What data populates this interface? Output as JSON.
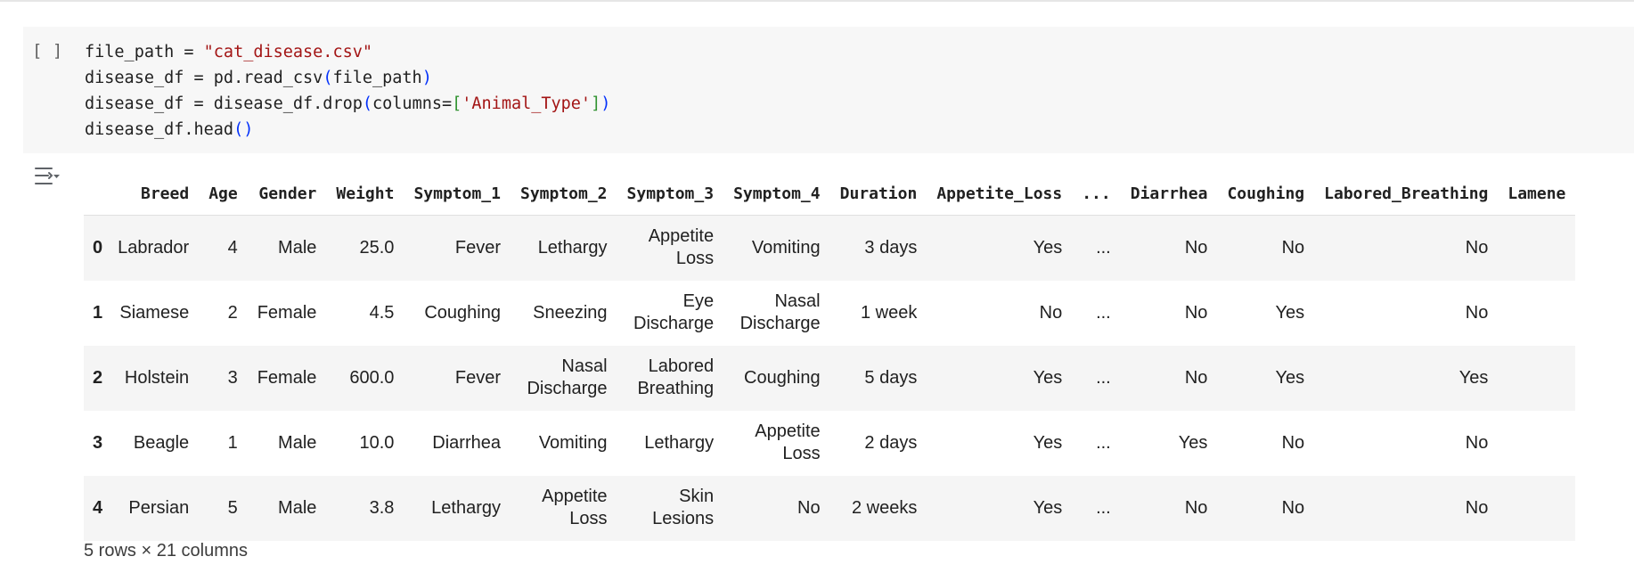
{
  "cell": {
    "run_indicator": "[ ]",
    "code": {
      "line1": {
        "a": "file_path = ",
        "s": "\"cat_disease.csv\""
      },
      "line2": {
        "a": "disease_df = pd.read_csv",
        "p1": "(",
        "b": "file_path",
        "p2": ")"
      },
      "line3": {
        "a": "disease_df = disease_df.drop",
        "p1": "(",
        "b": "columns=",
        "k1": "[",
        "s": "'Animal_Type'",
        "k2": "]",
        "p2": ")"
      },
      "line4": {
        "a": "disease_df.head",
        "p": "()"
      }
    }
  },
  "output": {
    "icon": "output-options-icon",
    "columns": [
      "",
      "Breed",
      "Age",
      "Gender",
      "Weight",
      "Symptom_1",
      "Symptom_2",
      "Symptom_3",
      "Symptom_4",
      "Duration",
      "Appetite_Loss",
      "...",
      "Diarrhea",
      "Coughing",
      "Labored_Breathing",
      "Lamene"
    ],
    "rows": [
      {
        "index": "0",
        "cells": [
          "Labrador",
          "4",
          "Male",
          "25.0",
          "Fever",
          "Lethargy",
          [
            "Appetite",
            "Loss"
          ],
          "Vomiting",
          "3 days",
          "Yes",
          "...",
          "No",
          "No",
          "No",
          ""
        ]
      },
      {
        "index": "1",
        "cells": [
          "Siamese",
          "2",
          "Female",
          "4.5",
          "Coughing",
          "Sneezing",
          [
            "Eye",
            "Discharge"
          ],
          [
            "Nasal",
            "Discharge"
          ],
          "1 week",
          "No",
          "...",
          "No",
          "Yes",
          "No",
          ""
        ]
      },
      {
        "index": "2",
        "cells": [
          "Holstein",
          "3",
          "Female",
          "600.0",
          "Fever",
          [
            "Nasal",
            "Discharge"
          ],
          [
            "Labored",
            "Breathing"
          ],
          "Coughing",
          "5 days",
          "Yes",
          "...",
          "No",
          "Yes",
          "Yes",
          ""
        ]
      },
      {
        "index": "3",
        "cells": [
          "Beagle",
          "1",
          "Male",
          "10.0",
          "Diarrhea",
          "Vomiting",
          "Lethargy",
          [
            "Appetite",
            "Loss"
          ],
          "2 days",
          "Yes",
          "...",
          "Yes",
          "No",
          "No",
          ""
        ]
      },
      {
        "index": "4",
        "cells": [
          "Persian",
          "5",
          "Male",
          "3.8",
          "Lethargy",
          [
            "Appetite",
            "Loss"
          ],
          [
            "Skin",
            "Lesions"
          ],
          "No",
          "2 weeks",
          "Yes",
          "...",
          "No",
          "No",
          "No",
          ""
        ]
      }
    ],
    "footer": "5 rows × 21 columns"
  }
}
